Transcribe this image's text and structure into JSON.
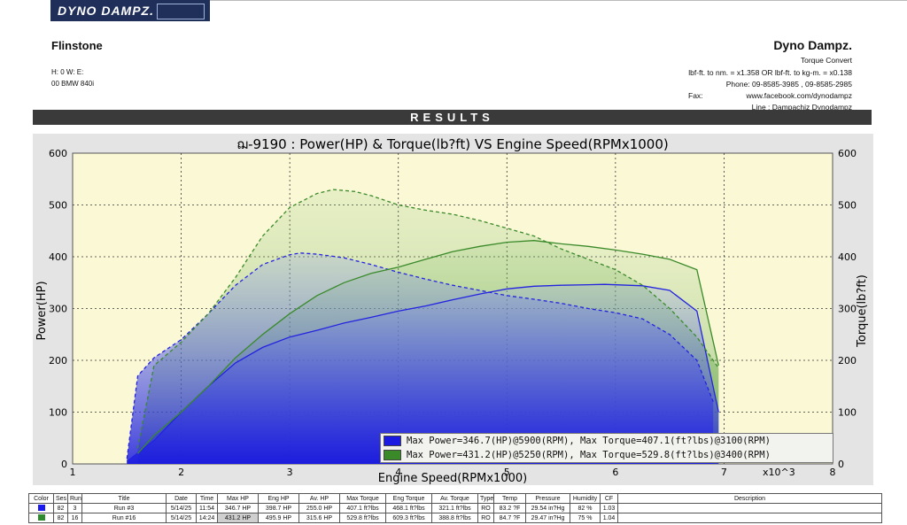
{
  "logo": {
    "text": "DYNO DAMPZ."
  },
  "customer": {
    "name": "Flinstone",
    "line1": "H:  0    W:       E:",
    "line2": "00 BMW 840i"
  },
  "company": {
    "name": "Dyno Dampz.",
    "line1": "Torque Convert",
    "line2": "lbf-ft. to nm. = x1.358 OR lbf-ft. to kg-m. = x0.138",
    "line3": "Phone: 09-8585-3985 , 09-8585-2985",
    "fax_label": "Fax:",
    "line4": "www.facebook.com/dynodampz",
    "line5": "Line : Dampachiz    Dynodampz"
  },
  "results_label": "RESULTS",
  "colors": {
    "run1": "#2323e0",
    "run2": "#3a8a2a",
    "plot_bg": "#fbf8d6",
    "frame": "#e4e4e4"
  },
  "chart_data": {
    "type": "line",
    "title": "ฌ-9190 : Power(HP) & Torque(lb?ft) VS Engine Speed(RPMx1000)",
    "xlabel": "Engine Speed(RPMx1000)",
    "xunit": "x10^3",
    "ylabel": "Power(HP)",
    "y2label": "Torque(lb?ft)",
    "xlim": [
      1,
      8
    ],
    "ylim": [
      0,
      600
    ],
    "y2lim": [
      0,
      600
    ],
    "xticks": [
      "1",
      "2",
      "3",
      "4",
      "5",
      "6",
      "7",
      "8"
    ],
    "yticks": [
      "0",
      "100",
      "200",
      "300",
      "400",
      "500",
      "600"
    ],
    "y2ticks": [
      "0",
      "100",
      "200",
      "300",
      "400",
      "500",
      "600"
    ],
    "grid": true,
    "series": [
      {
        "kind": "power",
        "run": "blue",
        "color": "#2323e0",
        "points": [
          [
            1.5,
            5
          ],
          [
            1.75,
            45
          ],
          [
            2.0,
            100
          ],
          [
            2.25,
            150
          ],
          [
            2.5,
            195
          ],
          [
            2.75,
            225
          ],
          [
            3.0,
            245
          ],
          [
            3.25,
            258
          ],
          [
            3.5,
            272
          ],
          [
            3.75,
            283
          ],
          [
            4.0,
            295
          ],
          [
            4.25,
            305
          ],
          [
            4.5,
            317
          ],
          [
            4.75,
            328
          ],
          [
            5.0,
            338
          ],
          [
            5.25,
            343
          ],
          [
            5.5,
            345
          ],
          [
            5.75,
            346
          ],
          [
            5.9,
            346.7
          ],
          [
            6.25,
            344
          ],
          [
            6.5,
            335
          ],
          [
            6.75,
            295
          ],
          [
            6.95,
            100
          ]
        ]
      },
      {
        "kind": "torque",
        "run": "blue",
        "color": "#2323e0",
        "points": [
          [
            1.5,
            10
          ],
          [
            1.6,
            170
          ],
          [
            1.75,
            205
          ],
          [
            2.0,
            240
          ],
          [
            2.25,
            290
          ],
          [
            2.5,
            345
          ],
          [
            2.75,
            385
          ],
          [
            3.0,
            404
          ],
          [
            3.1,
            407.1
          ],
          [
            3.25,
            405
          ],
          [
            3.5,
            398
          ],
          [
            3.75,
            385
          ],
          [
            4.0,
            370
          ],
          [
            4.25,
            357
          ],
          [
            4.5,
            345
          ],
          [
            4.75,
            335
          ],
          [
            5.0,
            325
          ],
          [
            5.25,
            318
          ],
          [
            5.5,
            310
          ],
          [
            5.75,
            300
          ],
          [
            6.0,
            292
          ],
          [
            6.25,
            280
          ],
          [
            6.5,
            250
          ],
          [
            6.75,
            200
          ],
          [
            6.9,
            120
          ]
        ]
      },
      {
        "kind": "power",
        "run": "green",
        "color": "#3a8a2a",
        "points": [
          [
            1.6,
            20
          ],
          [
            1.75,
            55
          ],
          [
            2.0,
            100
          ],
          [
            2.25,
            150
          ],
          [
            2.5,
            205
          ],
          [
            2.75,
            250
          ],
          [
            3.0,
            290
          ],
          [
            3.25,
            325
          ],
          [
            3.5,
            350
          ],
          [
            3.75,
            368
          ],
          [
            4.0,
            380
          ],
          [
            4.25,
            395
          ],
          [
            4.5,
            410
          ],
          [
            4.75,
            420
          ],
          [
            5.0,
            428
          ],
          [
            5.25,
            431.2
          ],
          [
            5.5,
            425
          ],
          [
            5.75,
            420
          ],
          [
            6.0,
            413
          ],
          [
            6.25,
            405
          ],
          [
            6.5,
            395
          ],
          [
            6.75,
            375
          ],
          [
            6.95,
            190
          ]
        ]
      },
      {
        "kind": "torque",
        "run": "green",
        "color": "#3a8a2a",
        "points": [
          [
            1.6,
            30
          ],
          [
            1.75,
            190
          ],
          [
            2.0,
            235
          ],
          [
            2.25,
            290
          ],
          [
            2.5,
            360
          ],
          [
            2.75,
            440
          ],
          [
            3.0,
            495
          ],
          [
            3.25,
            522
          ],
          [
            3.4,
            529.8
          ],
          [
            3.6,
            526
          ],
          [
            3.75,
            518
          ],
          [
            4.0,
            500
          ],
          [
            4.25,
            490
          ],
          [
            4.5,
            482
          ],
          [
            4.75,
            470
          ],
          [
            5.0,
            455
          ],
          [
            5.25,
            440
          ],
          [
            5.5,
            415
          ],
          [
            5.75,
            395
          ],
          [
            6.0,
            375
          ],
          [
            6.25,
            345
          ],
          [
            6.5,
            300
          ],
          [
            6.75,
            245
          ],
          [
            6.95,
            185
          ]
        ]
      }
    ],
    "legend": [
      {
        "text": "Max Power=346.7(HP)@5900(RPM), Max Torque=407.1(ft?lbs)@3100(RPM)",
        "color": "#2323e0"
      },
      {
        "text": "Max Power=431.2(HP)@5250(RPM), Max Torque=529.8(ft?lbs)@3400(RPM)",
        "color": "#3a8a2a"
      }
    ]
  },
  "table": {
    "headers": [
      "Color",
      "Ses",
      "Run",
      "Title",
      "Date",
      "Time",
      "Max HP",
      "Eng HP",
      "Av. HP",
      "Max Torque",
      "Eng Torque",
      "Av. Torque",
      "Type",
      "Temp",
      "Pressure",
      "Humidity",
      "CF",
      "Description"
    ],
    "rows": [
      {
        "color": "#1a1af0",
        "cells": [
          "82",
          "3",
          "Run #3",
          "5/14/25",
          "11:54",
          "346.7 HP",
          "398.7 HP",
          "255.0 HP",
          "407.1 ft?lbs",
          "468.1 ft?lbs",
          "321.1 ft?lbs",
          "RO",
          "83.2 ?F",
          "29.54 in?Hg",
          "82 %",
          "1.03",
          ""
        ]
      },
      {
        "color": "#2d8a2d",
        "cells": [
          "82",
          "16",
          "Run #16",
          "5/14/25",
          "14:24",
          "431.2 HP",
          "495.9 HP",
          "315.6 HP",
          "529.8 ft?lbs",
          "609.3 ft?lbs",
          "388.8 ft?lbs",
          "RO",
          "84.7 ?F",
          "29.47 in?Hg",
          "75 %",
          "1.04",
          ""
        ]
      }
    ]
  }
}
